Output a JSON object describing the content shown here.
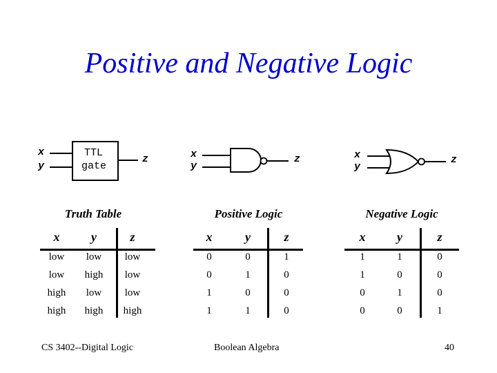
{
  "title": "Positive and Negative Logic",
  "diagrams": {
    "ttl": {
      "input1": "x",
      "input2": "y",
      "output": "z",
      "box_line1": "TTL",
      "box_line2": "gate"
    },
    "nand": {
      "input1": "x",
      "input2": "y",
      "output": "z",
      "gate_icon": "nand-gate-icon"
    },
    "nor": {
      "input1": "x",
      "input2": "y",
      "output": "z",
      "gate_icon": "nor-gate-icon"
    }
  },
  "tables": {
    "truth": {
      "title": "Truth Table",
      "headers": [
        "x",
        "y",
        "z"
      ],
      "rows": [
        [
          "low",
          "low",
          "low"
        ],
        [
          "low",
          "high",
          "low"
        ],
        [
          "high",
          "low",
          "low"
        ],
        [
          "high",
          "high",
          "high"
        ]
      ]
    },
    "positive": {
      "title": "Positive Logic",
      "headers": [
        "x",
        "y",
        "z"
      ],
      "rows": [
        [
          "0",
          "0",
          "1"
        ],
        [
          "0",
          "1",
          "0"
        ],
        [
          "1",
          "0",
          "0"
        ],
        [
          "1",
          "1",
          "0"
        ]
      ]
    },
    "negative": {
      "title": "Negative Logic",
      "headers": [
        "x",
        "y",
        "z"
      ],
      "rows": [
        [
          "1",
          "1",
          "0"
        ],
        [
          "1",
          "0",
          "0"
        ],
        [
          "0",
          "1",
          "0"
        ],
        [
          "0",
          "0",
          "1"
        ]
      ]
    }
  },
  "footer": {
    "left": "CS 3402--Digital Logic",
    "center": "Boolean Algebra",
    "page": "40"
  }
}
